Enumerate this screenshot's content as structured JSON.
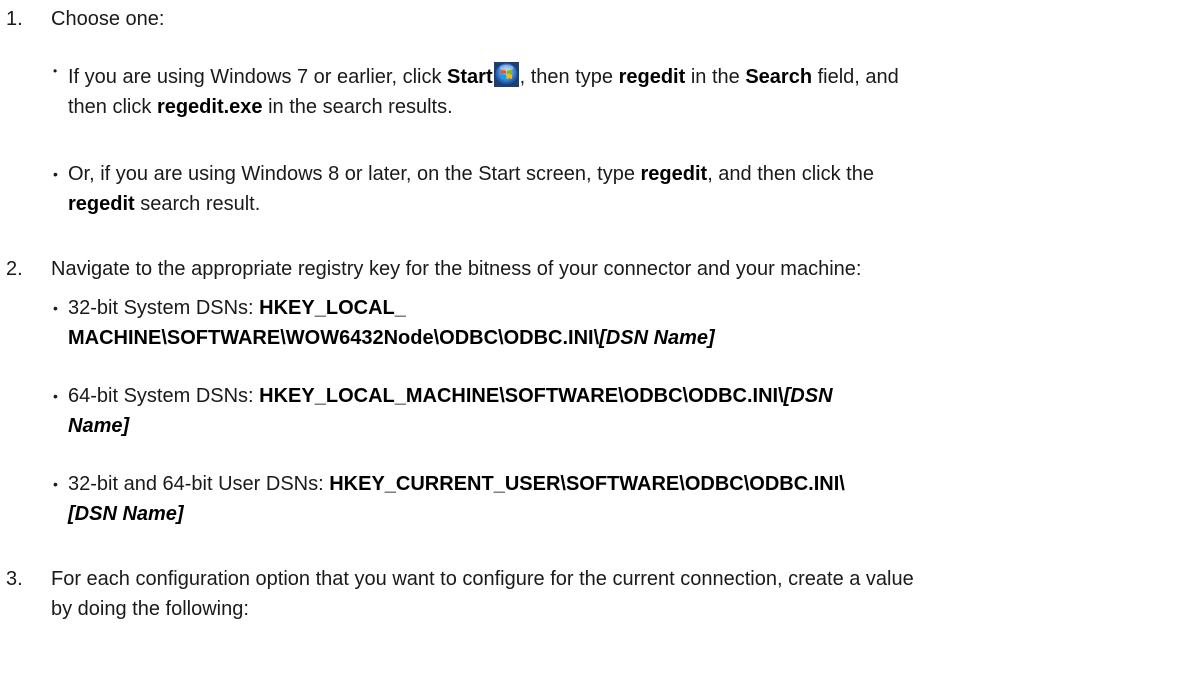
{
  "step1": {
    "number": "1.",
    "text": "Choose one:",
    "bullet_a": {
      "p1": "If you are using Windows 7 or earlier, click ",
      "b1": "Start",
      "p2": ", then type ",
      "b2": "regedit",
      "p3": " in the ",
      "b3": "Search",
      "p4": " field, and",
      "p5": "then click ",
      "b4": "regedit.exe",
      "p6": " in the search results."
    },
    "bullet_b": {
      "p1": "Or, if you are using Windows 8 or later, on the Start screen, type ",
      "b1": "regedit",
      "p2": ", and then click the",
      "b2": "regedit",
      "p3": " search result."
    }
  },
  "step2": {
    "number": "2.",
    "text": "Navigate to the appropriate registry key for the bitness of your connector and your machine:",
    "bullet_a": {
      "p1": "32-bit System DSNs: ",
      "b1": "HKEY_LOCAL_",
      "b2": "MACHINE\\SOFTWARE\\WOW6432Node\\ODBC\\ODBC.INI\\",
      "bi1": "[DSN Name]"
    },
    "bullet_b": {
      "p1": "64-bit System DSNs: ",
      "b1": "HKEY_LOCAL_MACHINE\\SOFTWARE\\ODBC\\ODBC.INI\\",
      "bi1": "[DSN",
      "bi2": "Name]"
    },
    "bullet_c": {
      "p1": "32-bit and 64-bit User DSNs: ",
      "b1": "HKEY_CURRENT_USER\\SOFTWARE\\ODBC\\ODBC.INI\\",
      "bi1": "[DSN Name]"
    }
  },
  "step3": {
    "number": "3.",
    "line1": "For each configuration option that you want to configure for the current connection, create a value",
    "line2": "by doing the following:"
  },
  "icons": {
    "start": "windows-start-orb-icon"
  }
}
